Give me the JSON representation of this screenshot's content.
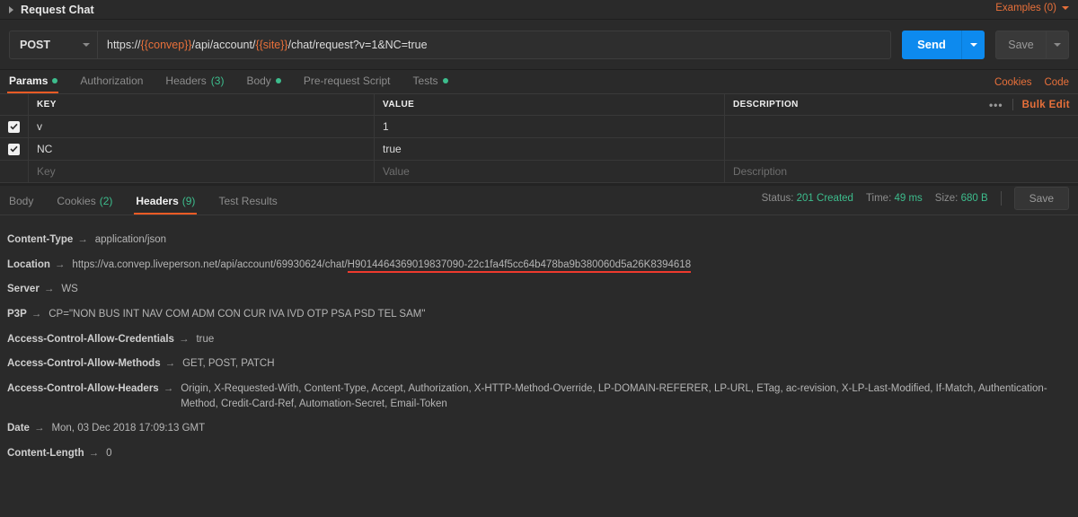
{
  "titlebar": {
    "collapse_icon": "triangle-right-icon",
    "request_name": "Request Chat",
    "examples_label": "Examples (0)",
    "examples_caret": "chevron-down-icon"
  },
  "url_bar": {
    "method": "POST",
    "method_caret": "chevron-down-icon",
    "url_prefix": "https://",
    "url_var1": "{{convep}}",
    "url_mid": "/api/account/",
    "url_var2": "{{site}}",
    "url_suffix": "/chat/request?v=1&NC=true",
    "url_full": "https://{{convep}}/api/account/{{site}}/chat/request?v=1&NC=true",
    "send_label": "Send",
    "send_caret": "chevron-down-icon",
    "save_label": "Save",
    "save_caret": "chevron-down-icon",
    "send_color": "#0d8aee"
  },
  "request_tabs": {
    "items": [
      {
        "label": "Params",
        "badge": "",
        "dot": true,
        "active": true
      },
      {
        "label": "Authorization",
        "badge": "",
        "dot": false,
        "active": false
      },
      {
        "label": "Headers",
        "badge": "(3)",
        "dot": false,
        "active": false
      },
      {
        "label": "Body",
        "badge": "",
        "dot": true,
        "active": false
      },
      {
        "label": "Pre-request Script",
        "badge": "",
        "dot": false,
        "active": false
      },
      {
        "label": "Tests",
        "badge": "",
        "dot": true,
        "active": false
      }
    ],
    "links": [
      "Cookies",
      "Code"
    ],
    "accent_color": "#ef5b25"
  },
  "params_table": {
    "columns": [
      "KEY",
      "VALUE",
      "DESCRIPTION"
    ],
    "more_icon": "ellipsis-icon",
    "bulk_edit_label": "Bulk Edit",
    "rows": [
      {
        "checked": true,
        "key": "v",
        "value": "1",
        "description": ""
      },
      {
        "checked": true,
        "key": "NC",
        "value": "true",
        "description": ""
      }
    ],
    "new_row": {
      "key_placeholder": "Key",
      "value_placeholder": "Value",
      "description_placeholder": "Description"
    }
  },
  "response": {
    "tabs": [
      {
        "label": "Body",
        "badge": "",
        "active": false
      },
      {
        "label": "Cookies",
        "badge": "(2)",
        "active": false
      },
      {
        "label": "Headers",
        "badge": "(9)",
        "active": true
      },
      {
        "label": "Test Results",
        "badge": "",
        "active": false
      }
    ],
    "status_label": "Status:",
    "status_value": "201 Created",
    "time_label": "Time:",
    "time_value": "49 ms",
    "size_label": "Size:",
    "size_value": "680 B",
    "save_label": "Save",
    "status_color": "#3dbd8d",
    "headers": [
      {
        "name": "Content-Type",
        "value": "application/json",
        "highlight": ""
      },
      {
        "name": "Location",
        "value": "https://va.convep.liveperson.net/api/account/69930624/chat/",
        "highlight": "H9014464369019837090-22c1fa4f5cc64b478ba9b380060d5a26K8394618"
      },
      {
        "name": "Server",
        "value": "WS",
        "highlight": ""
      },
      {
        "name": "P3P",
        "value": "CP=\"NON BUS INT NAV COM ADM CON CUR IVA IVD OTP PSA PSD TEL SAM\"",
        "highlight": ""
      },
      {
        "name": "Access-Control-Allow-Credentials",
        "value": "true",
        "highlight": ""
      },
      {
        "name": "Access-Control-Allow-Methods",
        "value": "GET, POST, PATCH",
        "highlight": ""
      },
      {
        "name": "Access-Control-Allow-Headers",
        "value": "Origin, X-Requested-With, Content-Type, Accept, Authorization, X-HTTP-Method-Override, LP-DOMAIN-REFERER, LP-URL, ETag, ac-revision, X-LP-Last-Modified, If-Match, Authentication-Method, Credit-Card-Ref, Automation-Secret, Email-Token",
        "highlight": ""
      },
      {
        "name": "Date",
        "value": "Mon, 03 Dec 2018 17:09:13 GMT",
        "highlight": ""
      },
      {
        "name": "Content-Length",
        "value": "0",
        "highlight": ""
      }
    ],
    "arrow_glyph": "→",
    "highlight_color": "#ef3a2d"
  }
}
